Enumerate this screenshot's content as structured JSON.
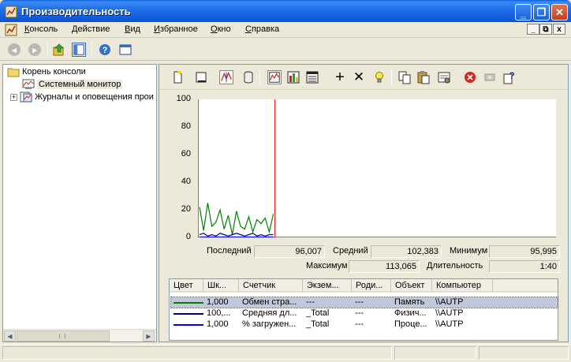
{
  "window": {
    "title": "Производительность",
    "icon": "performance-app-icon",
    "controls": [
      "minimize-icon",
      "maximize-icon",
      "close-icon"
    ]
  },
  "menu": {
    "items": [
      {
        "key": "К",
        "rest": "онсоль"
      },
      {
        "key": "Д",
        "rest": "ействие"
      },
      {
        "key": "В",
        "rest": "ид"
      },
      {
        "key": "И",
        "rest": "збранное"
      },
      {
        "key": "О",
        "rest": "кно"
      },
      {
        "key": "С",
        "rest": "правка"
      }
    ],
    "mdi_controls": [
      "_",
      "⧉",
      "x"
    ]
  },
  "toolbar": {
    "icons": [
      "back-icon",
      "forward-icon",
      "up-level-icon",
      "show-hide-tree-icon",
      "help-icon",
      "new-window-icon"
    ]
  },
  "tree": {
    "root": "Корень консоли",
    "items": [
      {
        "label": "Системный монитор",
        "selected": true
      },
      {
        "label": "Журналы и оповещения прои",
        "expander": "+"
      }
    ]
  },
  "sysmon_toolbar": {
    "icons": [
      "new-counter-set-icon",
      "clear-display-icon",
      "view-current-activity-icon",
      "view-log-data-icon",
      "view-graph-icon",
      "view-histogram-icon",
      "view-report-icon",
      "add-counter-icon",
      "delete-counter-icon",
      "highlight-icon",
      "copy-properties-icon",
      "paste-counter-list-icon",
      "properties-icon",
      "freeze-display-icon",
      "update-data-icon",
      "help-icon"
    ]
  },
  "chart_data": {
    "type": "line",
    "ylim": [
      0,
      100
    ],
    "yticks": [
      "100",
      "80",
      "60",
      "40",
      "20",
      "0"
    ],
    "grid": false,
    "current_position_marker_color": "#ff0000",
    "series": [
      {
        "color": "#008000",
        "values": [
          22,
          5,
          25,
          8,
          11,
          20,
          6,
          16,
          2,
          19,
          8,
          6,
          15,
          4,
          13,
          10,
          14,
          4,
          17
        ]
      },
      {
        "color": "#000080",
        "values": [
          2,
          3,
          1,
          2,
          1,
          3,
          2,
          1,
          2,
          3,
          2,
          1,
          2,
          3,
          1,
          2,
          1,
          2,
          2
        ]
      },
      {
        "color": "#0000ff",
        "values": [
          0.3,
          0.3,
          0.3,
          0.3,
          0.3,
          0.3,
          0.3,
          0.3,
          0.3,
          0.3,
          0.3,
          0.3,
          0.3,
          0.3,
          0.3,
          0.3,
          0.3,
          0.3,
          0.3
        ]
      }
    ]
  },
  "stats": {
    "last_label": "Последний",
    "last_value": "96,007",
    "avg_label": "Средний",
    "avg_value": "102,383",
    "min_label": "Минимум",
    "min_value": "95,995",
    "max_label": "Максимум",
    "max_value": "113,065",
    "dur_label": "Длительность",
    "dur_value": "1:40"
  },
  "counters": {
    "headers": [
      "Цвет",
      "Шк...",
      "Счетчик",
      "Экзем...",
      "Роди...",
      "Объект",
      "Компьютер"
    ],
    "rows": [
      {
        "color": "#008000",
        "scale": "1,000",
        "counter": "Обмен стра...",
        "instance": "---",
        "parent": "---",
        "object": "Память",
        "computer": "\\\\AUTP"
      },
      {
        "color": "#000080",
        "scale": "100,...",
        "counter": "Средняя дл...",
        "instance": "_Total",
        "parent": "---",
        "object": "Физич...",
        "computer": "\\\\AUTP"
      },
      {
        "color": "#0000ff",
        "scale": "1,000",
        "counter": "% загружен...",
        "instance": "_Total",
        "parent": "---",
        "object": "Проце...",
        "computer": "\\\\AUTP"
      }
    ]
  }
}
